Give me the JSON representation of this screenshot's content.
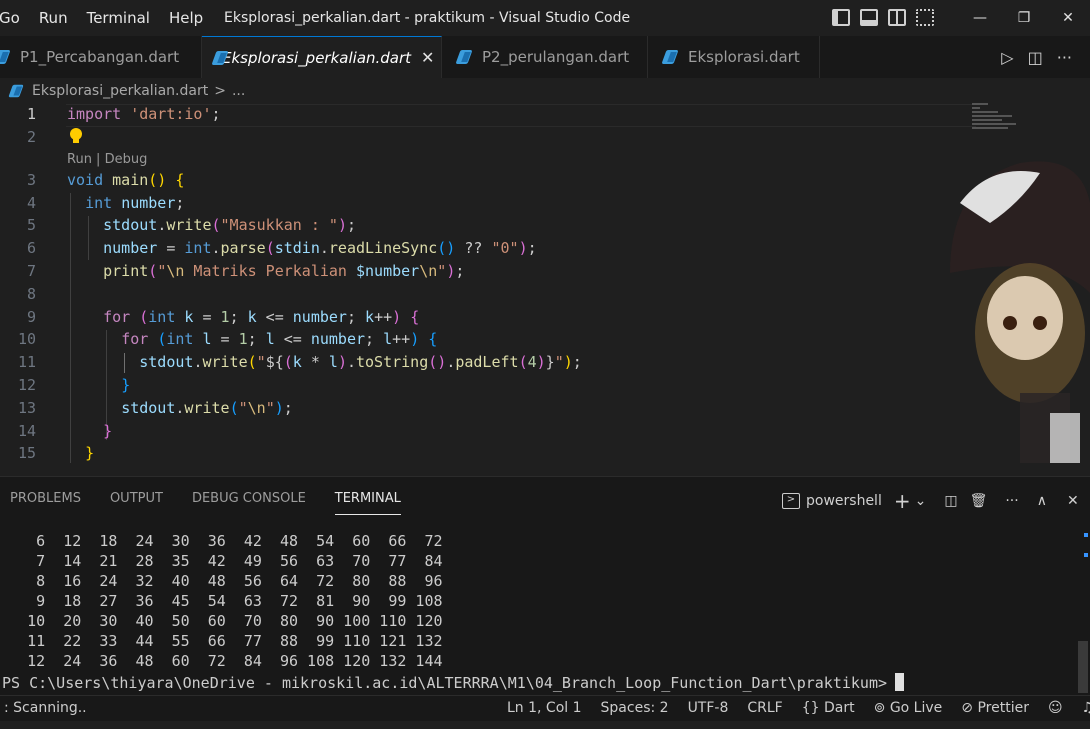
{
  "menu": [
    "Go",
    "Run",
    "Terminal",
    "Help"
  ],
  "window_title": "Eksplorasi_perkalian.dart - praktikum - Visual Studio Code",
  "window_controls": {
    "minimize": "—",
    "restore": "❐",
    "close": "✕"
  },
  "tabs": [
    {
      "label": "P1_Percabangan.dart",
      "active": false
    },
    {
      "label": "Eksplorasi_perkalian.dart",
      "active": true
    },
    {
      "label": "P2_perulangan.dart",
      "active": false
    },
    {
      "label": "Eksplorasi.dart",
      "active": false
    }
  ],
  "tab_close": "✕",
  "tab_actions": {
    "run": "▷",
    "split": "◫",
    "more": "···"
  },
  "breadcrumb": {
    "file": "Eksplorasi_perkalian.dart",
    "separator": ">",
    "more": "..."
  },
  "editor": {
    "line_numbers": [
      "1",
      "2",
      "3",
      "4",
      "5",
      "6",
      "7",
      "8",
      "9",
      "10",
      "11",
      "12",
      "13",
      "14",
      "15"
    ],
    "current_line": "1",
    "codelens": "Run | Debug"
  },
  "panel": {
    "tabs": [
      "PROBLEMS",
      "OUTPUT",
      "DEBUG CONSOLE",
      "TERMINAL"
    ],
    "active_tab": "TERMINAL",
    "shell": "powershell",
    "actions": {
      "new": "+",
      "dropdown": "⌄",
      "split": "◫",
      "kill": "🗑",
      "more": "···",
      "maximize": "∧",
      "close": "✕"
    },
    "terminal_rows": [
      "    6  12  18  24  30  36  42  48  54  60  66  72",
      "    7  14  21  28  35  42  49  56  63  70  77  84",
      "    8  16  24  32  40  48  56  64  72  80  88  96",
      "    9  18  27  36  45  54  63  72  81  90  99 108",
      "   10  20  30  40  50  60  70  80  90 100 110 120",
      "   11  22  33  44  55  66  77  88  99 110 121 132",
      "   12  24  36  48  60  72  84  96 108 120 132 144"
    ],
    "prompt": "PS C:\\Users\\thiyara\\OneDrive - mikroskil.ac.id\\ALTERRRA\\M1\\04_Branch_Loop_Function_Dart\\praktikum>"
  },
  "status": {
    "left": ": Scanning..",
    "position": "Ln 1, Col 1",
    "spaces": "Spaces: 2",
    "encoding": "UTF-8",
    "eol": "CRLF",
    "language": "Dart",
    "golive": "Go Live",
    "prettier": "Prettier"
  },
  "colors": {
    "accent": "#0078d4",
    "editor_bg": "#1f1f1f",
    "panel_bg": "#181818",
    "keyword": "#569cd6",
    "string": "#ce9178"
  }
}
